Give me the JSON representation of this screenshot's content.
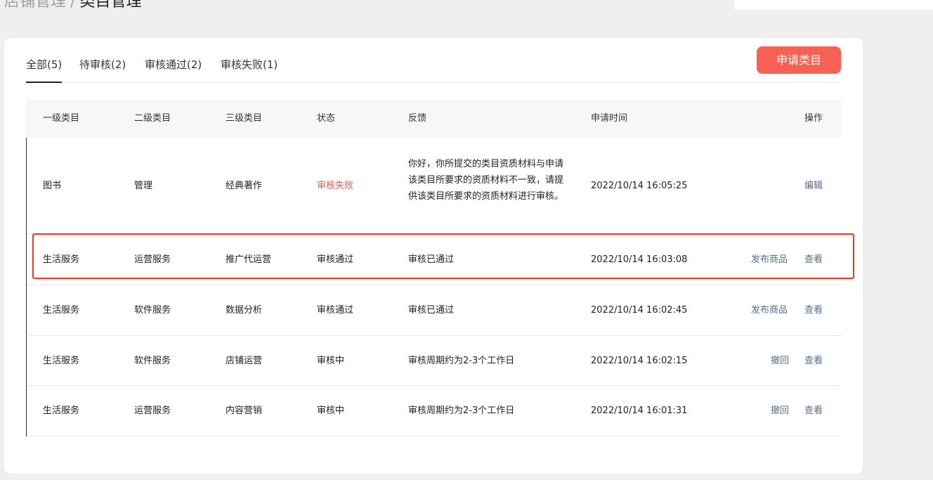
{
  "breadcrumb": {
    "parent": "店铺管理",
    "separator": "/",
    "current": "类目管理"
  },
  "tabs": [
    {
      "label": "全部(5)",
      "active": true
    },
    {
      "label": "待审核(2)",
      "active": false
    },
    {
      "label": "审核通过(2)",
      "active": false
    },
    {
      "label": "审核失败(1)",
      "active": false
    }
  ],
  "apply_button": "申请类目",
  "table": {
    "headers": {
      "level1": "一级类目",
      "level2": "二级类目",
      "level3": "三级类目",
      "status": "状态",
      "feedback": "反馈",
      "time": "申请时间",
      "ops": "操作"
    },
    "rows": [
      {
        "level1": "图书",
        "level2": "管理",
        "level3": "经典著作",
        "status": "审核失败",
        "feedback": "你好，你所提交的类目资质材料与申请该类目所要求的资质材料不一致，请提供该类目所要求的资质材料进行审核。",
        "time": "2022/10/14 16:05:25",
        "actions": [
          "编辑"
        ]
      },
      {
        "level1": "生活服务",
        "level2": "运营服务",
        "level3": "推广代运营",
        "status": "审核通过",
        "feedback": "审核已通过",
        "time": "2022/10/14 16:03:08",
        "actions": [
          "发布商品",
          "查看"
        ]
      },
      {
        "level1": "生活服务",
        "level2": "软件服务",
        "level3": "数据分析",
        "status": "审核通过",
        "feedback": "审核已通过",
        "time": "2022/10/14 16:02:45",
        "actions": [
          "发布商品",
          "查看"
        ]
      },
      {
        "level1": "生活服务",
        "level2": "软件服务",
        "level3": "店铺运营",
        "status": "审核中",
        "feedback": "审核周期约为2-3个工作日",
        "time": "2022/10/14 16:02:15",
        "actions": [
          "撤回",
          "查看"
        ]
      },
      {
        "level1": "生活服务",
        "level2": "运营服务",
        "level3": "内容营销",
        "status": "审核中",
        "feedback": "审核周期约为2-3个工作日",
        "time": "2022/10/14 16:01:31",
        "actions": [
          "撤回",
          "查看"
        ]
      }
    ]
  },
  "colors": {
    "accent": "#f76154",
    "fail": "#f0564b",
    "link": "#5a6c8c",
    "highlight": "#e8362b"
  }
}
